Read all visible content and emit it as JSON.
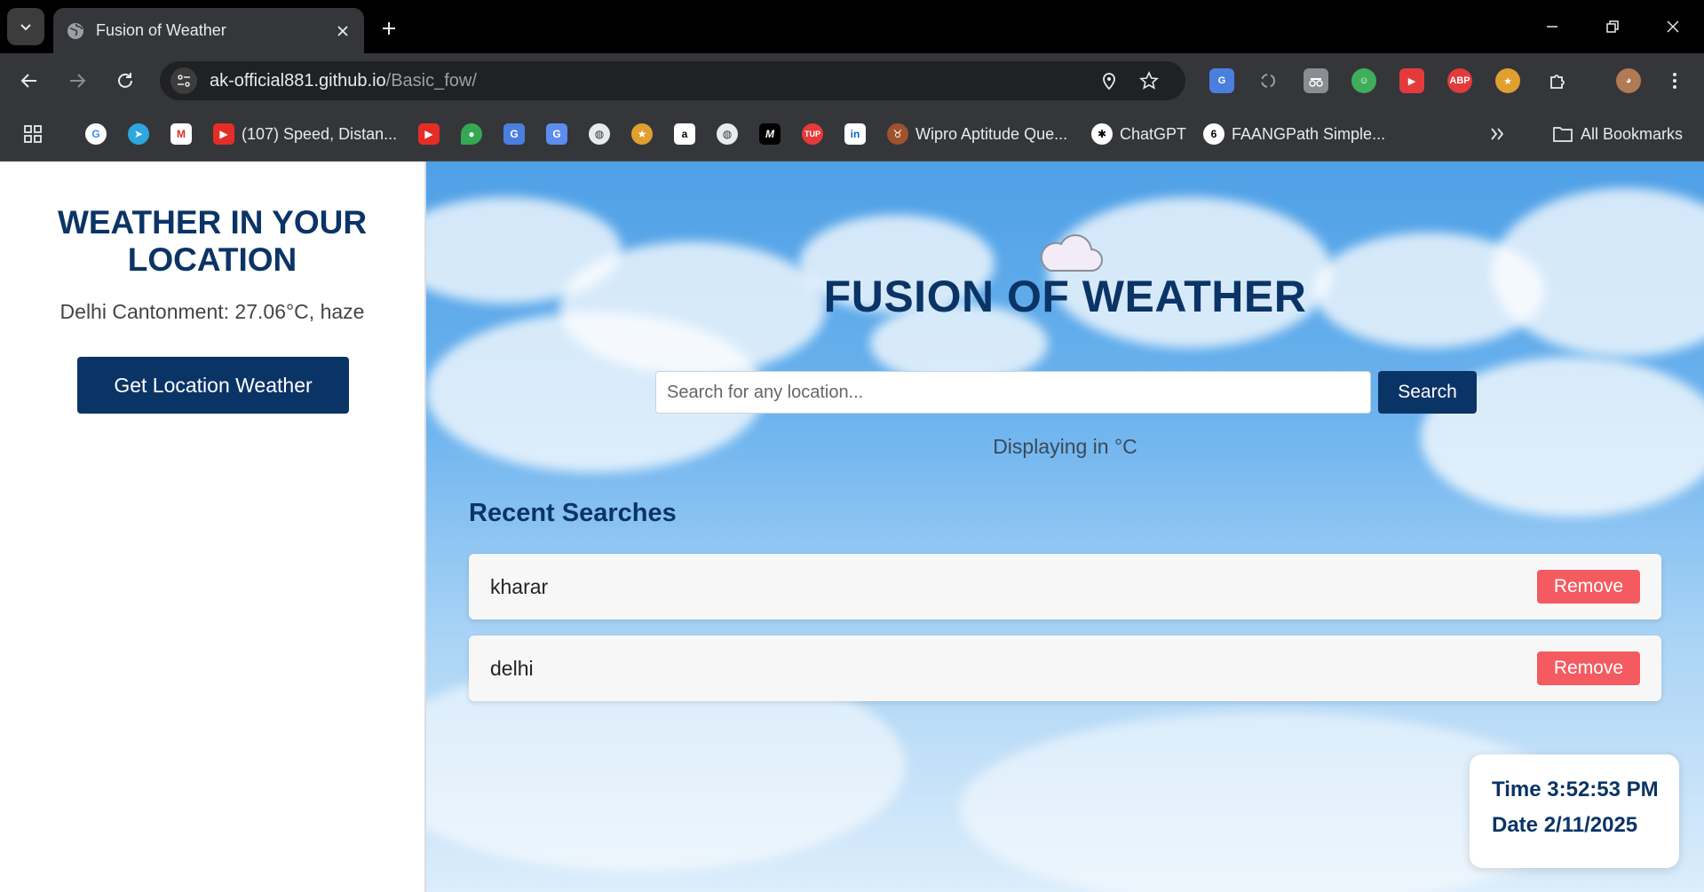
{
  "browser": {
    "tab_title": "Fusion of Weather",
    "url_host": "ak-official881.github.io",
    "url_path": "/Basic_fow/",
    "bookmarks": [
      {
        "label": "(107) Speed, Distan...",
        "icon": "youtube-icon"
      },
      {
        "label": "Wipro Aptitude Que...",
        "icon": "cow-icon"
      },
      {
        "label": "ChatGPT",
        "icon": "chatgpt-icon"
      },
      {
        "label": "FAANGPath Simple...",
        "icon": "faangpath-icon"
      },
      {
        "label": "All Bookmarks",
        "icon": "folder-icon"
      }
    ],
    "extensions": [
      "google-translate-icon",
      "sync-icon",
      "incognito-icon",
      "robot-icon",
      "video-ext-icon",
      "abp-icon",
      "medal-icon",
      "puzzle-icon",
      "profile-avatar-icon"
    ],
    "abp_label": "ABP"
  },
  "sidebar": {
    "heading": "WEATHER IN YOUR LOCATION",
    "location_weather": "Delhi Cantonment: 27.06°C, haze",
    "button_label": "Get Location Weather"
  },
  "main": {
    "title": "FUSION OF WEATHER",
    "search_placeholder": "Search for any location...",
    "search_button": "Search",
    "units_text": "Displaying in °C",
    "recent_title": "Recent Searches",
    "recent_items": [
      {
        "city": "kharar",
        "action": "Remove"
      },
      {
        "city": "delhi",
        "action": "Remove"
      }
    ],
    "clock": {
      "time": "Time 3:52:53 PM",
      "date": "Date 2/11/2025"
    }
  },
  "colors": {
    "primary": "#0b3466",
    "remove": "#f45b60",
    "sky_top": "#4fa0e6"
  }
}
